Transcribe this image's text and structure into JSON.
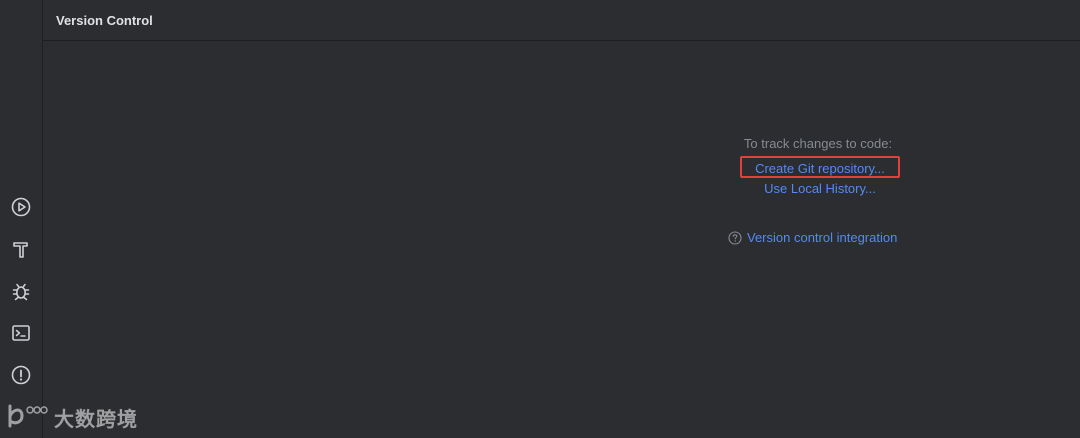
{
  "toolwindow": {
    "title": "Version Control"
  },
  "empty_state": {
    "hint": "To track changes to code:",
    "create_git_label": "Create Git repository...",
    "local_history_label": "Use Local History...",
    "help_link_label": "Version control integration"
  },
  "toolstrip": {
    "items": [
      {
        "icon": "run-icon"
      },
      {
        "icon": "build-hammer-icon"
      },
      {
        "icon": "debug-bug-icon"
      },
      {
        "icon": "terminal-icon"
      },
      {
        "icon": "problems-icon"
      }
    ]
  },
  "watermark": {
    "text": "大数跨境"
  },
  "colors": {
    "background": "#2b2d30",
    "link": "#548af7",
    "hint": "#868a91",
    "highlight_border": "#e2403a",
    "title": "#dfe1e5"
  }
}
